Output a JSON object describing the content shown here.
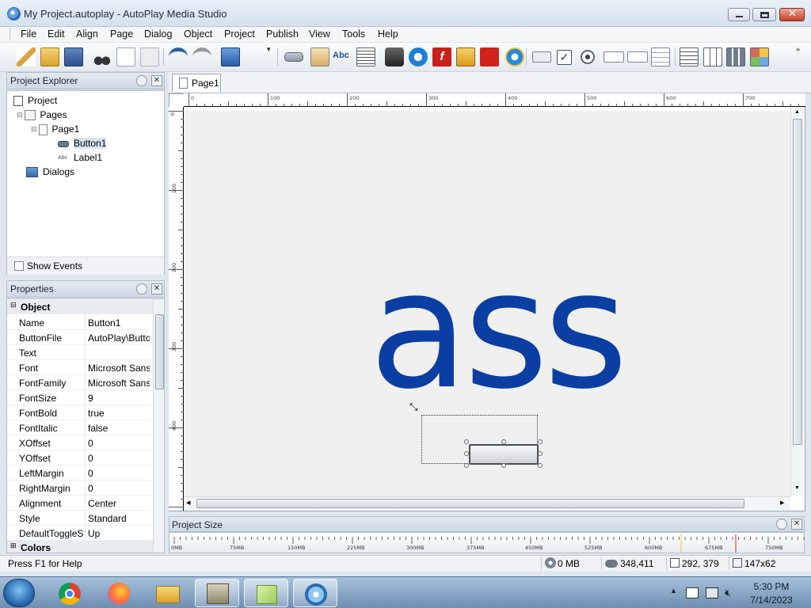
{
  "window": {
    "title": "My Project.autoplay - AutoPlay Media Studio",
    "close_glyph": "✕"
  },
  "menu": [
    "File",
    "Edit",
    "Align",
    "Page",
    "Dialog",
    "Object",
    "Project",
    "Publish",
    "View",
    "Tools",
    "Help"
  ],
  "project_explorer": {
    "title": "Project Explorer",
    "tree": {
      "root": "Project",
      "pages": "Pages",
      "page1": "Page1",
      "button1": "Button1",
      "label1": "Label1",
      "dialogs": "Dialogs"
    },
    "show_events": "Show Events"
  },
  "properties": {
    "title": "Properties",
    "section_object": "Object",
    "section_colors": "Colors",
    "rows": [
      {
        "key": "Name",
        "value": "Button1"
      },
      {
        "key": "ButtonFile",
        "value": "AutoPlay\\Butto"
      },
      {
        "key": "Text",
        "value": ""
      },
      {
        "key": "Font",
        "value": "Microsoft Sans"
      },
      {
        "key": "FontFamily",
        "value": "Microsoft Sans"
      },
      {
        "key": "FontSize",
        "value": "9"
      },
      {
        "key": "FontBold",
        "value": "true"
      },
      {
        "key": "FontItalic",
        "value": "false"
      },
      {
        "key": "XOffset",
        "value": "0"
      },
      {
        "key": "YOffset",
        "value": "0"
      },
      {
        "key": "LeftMargin",
        "value": "0"
      },
      {
        "key": "RightMargin",
        "value": "0"
      },
      {
        "key": "Alignment",
        "value": "Center"
      },
      {
        "key": "Style",
        "value": "Standard"
      },
      {
        "key": "DefaultToggleS",
        "value": "Up"
      }
    ]
  },
  "document": {
    "tab": "Page1",
    "ruler_top": [
      "0",
      "100",
      "200",
      "300",
      "400",
      "500",
      "600",
      "700"
    ],
    "ruler_left": [
      "0",
      "100",
      "200",
      "300",
      "400"
    ],
    "label_text": "ass"
  },
  "project_size": {
    "title": "Project Size",
    "ticks": [
      "0MB",
      "75MB",
      "150MB",
      "225MB",
      "300MB",
      "375MB",
      "450MB",
      "525MB",
      "600MB",
      "675MB",
      "750MB"
    ]
  },
  "status": {
    "help": "Press F1 for Help",
    "size": "0 MB",
    "memory": "348,411",
    "position": "292, 379",
    "dimensions": "147x62"
  },
  "taskbar": {
    "time": "5:30 PM",
    "date": "7/14/2023"
  },
  "colors": {
    "label_text": "#0a3ea2",
    "accent": "#1d5fb2"
  }
}
